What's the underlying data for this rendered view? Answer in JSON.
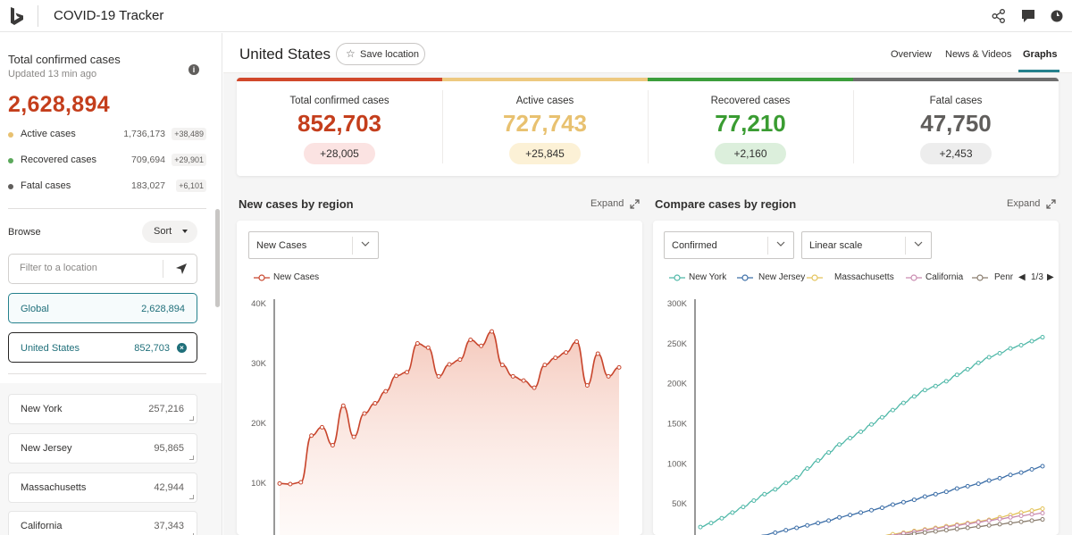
{
  "app": {
    "title": "COVID-19 Tracker"
  },
  "sidebar": {
    "title": "Total confirmed cases",
    "updated": "Updated 13 min ago",
    "total": "2,628,894",
    "stats": [
      {
        "label": "Active cases",
        "value": "1,736,173",
        "delta": "+38,489",
        "color": "#e8c170"
      },
      {
        "label": "Recovered cases",
        "value": "709,694",
        "delta": "+29,901",
        "color": "#5ba85b"
      },
      {
        "label": "Fatal cases",
        "value": "183,027",
        "delta": "+6,101",
        "color": "#605e5c"
      }
    ],
    "browse_label": "Browse",
    "sort_label": "Sort",
    "filter_placeholder": "Filter to a location",
    "global": {
      "name": "Global",
      "value": "2,628,894"
    },
    "selected": {
      "name": "United States",
      "value": "852,703"
    },
    "regions": [
      {
        "name": "New York",
        "value": "257,216"
      },
      {
        "name": "New Jersey",
        "value": "95,865"
      },
      {
        "name": "Massachusetts",
        "value": "42,944"
      },
      {
        "name": "California",
        "value": "37,343"
      }
    ]
  },
  "header": {
    "country": "United States",
    "save_label": "Save location",
    "tabs": [
      "Overview",
      "News & Videos",
      "Graphs"
    ],
    "active_tab": "Graphs"
  },
  "summary": [
    {
      "label": "Total confirmed cases",
      "value": "852,703",
      "delta": "+28,005",
      "color": "#c43e1c",
      "bar": "#d1482b",
      "pill": "#fbe3e2"
    },
    {
      "label": "Active cases",
      "value": "727,743",
      "delta": "+25,845",
      "color": "#e8c170",
      "bar": "#edc980",
      "pill": "#fcf1d6"
    },
    {
      "label": "Recovered cases",
      "value": "77,210",
      "delta": "+2,160",
      "color": "#3a9c32",
      "bar": "#3c9e3c",
      "pill": "#dcefdc"
    },
    {
      "label": "Fatal cases",
      "value": "47,750",
      "delta": "+2,453",
      "color": "#605e5c",
      "bar": "#6e6e6e",
      "pill": "#ededed"
    }
  ],
  "panels": {
    "left": {
      "title": "New cases by region",
      "expand": "Expand",
      "dropdown": "New Cases",
      "legend": "New Cases"
    },
    "right": {
      "title": "Compare cases by region",
      "expand": "Expand",
      "dropdown1": "Confirmed",
      "dropdown2": "Linear scale",
      "legend": [
        {
          "name": "New York",
          "color": "#4fb8a8"
        },
        {
          "name": "New Jersey",
          "color": "#3d6fa8"
        },
        {
          "name": "Massachusetts",
          "color": "#e3c35a"
        },
        {
          "name": "California",
          "color": "#c98bb0"
        },
        {
          "name": "Penr",
          "color": "#8a7d6e"
        }
      ],
      "pager": "1/3"
    }
  },
  "chart_data": [
    {
      "type": "area",
      "title": "New cases by region",
      "yticks": [
        "40K",
        "30K",
        "20K",
        "10K"
      ],
      "ylim": [
        0,
        40000
      ],
      "series": [
        {
          "name": "New Cases",
          "color": "#c8452c",
          "values": [
            9800,
            9700,
            10000,
            17800,
            19200,
            16200,
            22800,
            17600,
            21500,
            23200,
            25200,
            27800,
            28400,
            33200,
            32500,
            27700,
            29700,
            30500,
            33800,
            32800,
            35200,
            29600,
            27700,
            27000,
            25800,
            29600,
            30800,
            31700,
            33500,
            26200,
            31500,
            27700,
            29200
          ]
        }
      ]
    },
    {
      "type": "line",
      "title": "Compare cases by region",
      "yticks": [
        "300K",
        "250K",
        "200K",
        "150K",
        "100K",
        "50K"
      ],
      "ylim": [
        0,
        300000
      ],
      "series": [
        {
          "name": "New York",
          "color": "#4fb8a8",
          "values": [
            20000,
            25000,
            31000,
            38000,
            45000,
            53000,
            61000,
            67000,
            75000,
            82000,
            93000,
            103000,
            113000,
            123000,
            131000,
            139000,
            148000,
            157000,
            166000,
            175000,
            183000,
            191000,
            196000,
            202000,
            210000,
            217000,
            225000,
            232000,
            237000,
            243000,
            247000,
            252000,
            257000
          ]
        },
        {
          "name": "New Jersey",
          "color": "#3d6fa8",
          "values": [
            0,
            0,
            0,
            2000,
            4000,
            7000,
            10000,
            13000,
            16000,
            19000,
            22000,
            25000,
            28000,
            32000,
            35000,
            38000,
            41000,
            44000,
            48000,
            51000,
            54000,
            58000,
            61000,
            64000,
            68000,
            71000,
            74000,
            78000,
            81000,
            85000,
            88000,
            92000,
            95865
          ]
        },
        {
          "name": "Massachusetts",
          "color": "#e3c35a",
          "values": [
            0,
            0,
            0,
            0,
            0,
            0,
            0,
            0,
            0,
            0,
            0,
            1000,
            2000,
            3000,
            4000,
            5000,
            7000,
            9000,
            11000,
            13000,
            15000,
            17000,
            19000,
            21000,
            23000,
            25000,
            27000,
            29000,
            32000,
            35000,
            38000,
            40500,
            42944
          ]
        },
        {
          "name": "California",
          "color": "#c98bb0",
          "values": [
            0,
            0,
            0,
            0,
            0,
            0,
            0,
            0,
            0,
            0,
            0,
            1000,
            2000,
            3000,
            4000,
            5000,
            6500,
            8000,
            10000,
            12000,
            14000,
            16000,
            18000,
            20000,
            22000,
            24000,
            26000,
            28000,
            30000,
            32000,
            34000,
            35800,
            37343
          ]
        },
        {
          "name": "Penr",
          "color": "#8a7d6e",
          "values": [
            0,
            0,
            0,
            0,
            0,
            0,
            0,
            0,
            0,
            0,
            0,
            800,
            1600,
            2500,
            3500,
            4500,
            5800,
            7000,
            8500,
            10000,
            11500,
            13000,
            14500,
            16000,
            17500,
            19000,
            20500,
            22000,
            23500,
            25000,
            26500,
            28000,
            29500
          ]
        }
      ]
    }
  ]
}
